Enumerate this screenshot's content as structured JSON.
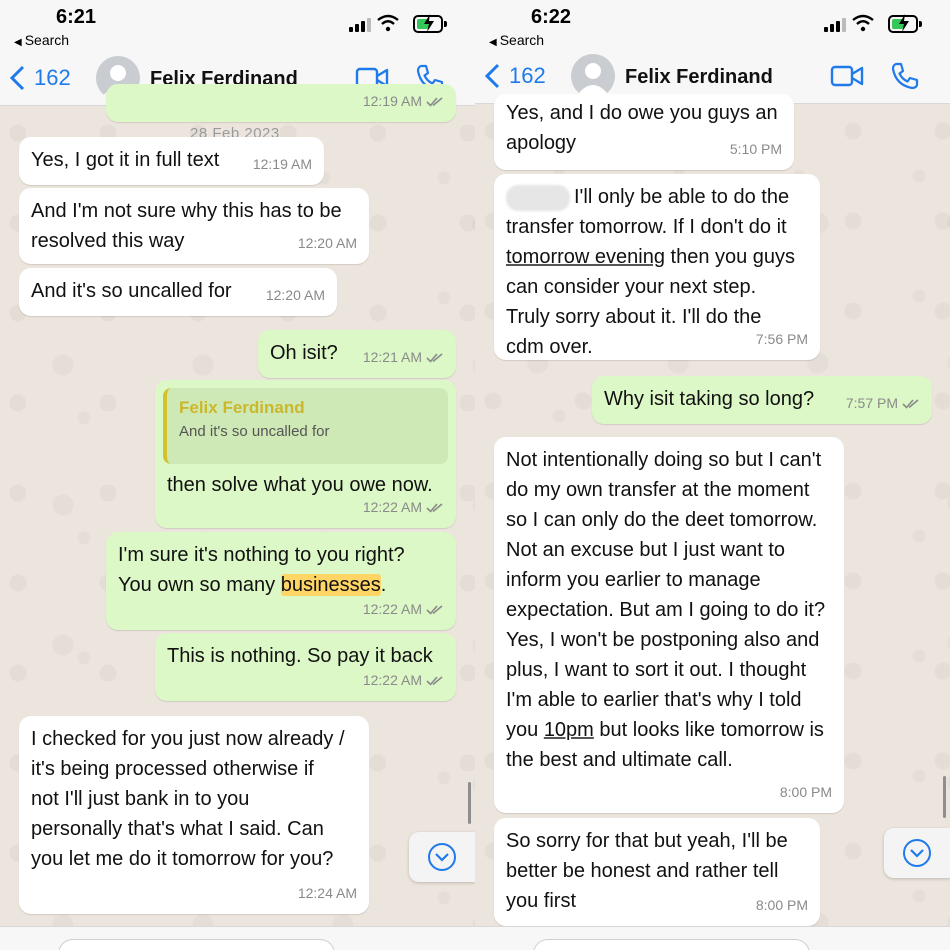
{
  "left": {
    "status": {
      "time": "6:21",
      "back_app": "Search"
    },
    "header": {
      "back_count": "162",
      "contact_name": "Felix Ferdinand"
    },
    "date_chip": "28 Feb 2023",
    "top_partial_time": "12:19 AM",
    "messages": [
      {
        "dir": "in",
        "text": "Yes, I got it in full text",
        "time": "12:19 AM"
      },
      {
        "dir": "in",
        "text": "And I'm not sure why this has to be resolved this way",
        "time": "12:20 AM"
      },
      {
        "dir": "in",
        "text": "And it's so uncalled for",
        "time": "12:20 AM"
      },
      {
        "dir": "out",
        "text": "Oh isit?",
        "time": "12:21 AM"
      },
      {
        "dir": "out",
        "quote_name": "Felix Ferdinand",
        "quote_text": "And it's so uncalled for",
        "text": "then solve what you owe now.",
        "time": "12:22 AM"
      },
      {
        "dir": "out",
        "text_a": "I'm sure it's nothing to you right? You own so many ",
        "text_hl": "businesses",
        "text_b": ".",
        "time": "12:22 AM"
      },
      {
        "dir": "out",
        "text": "This is nothing. So pay it back",
        "time": "12:22 AM"
      },
      {
        "dir": "in",
        "text": "I checked for you just now already / it's being processed otherwise if not I'll just bank in to you personally that's what I said. Can you let me do it tomorrow for you?",
        "time": "12:24 AM"
      }
    ]
  },
  "right": {
    "status": {
      "time": "6:22",
      "back_app": "Search"
    },
    "header": {
      "back_count": "162",
      "contact_name": "Felix Ferdinand"
    },
    "messages": [
      {
        "dir": "in",
        "text": "Yes, and I do owe you guys an apology",
        "time": "5:10 PM"
      },
      {
        "dir": "in",
        "text_a": "I'll only be able to do the transfer tomorrow. If I don't do it ",
        "text_ul": "tomorrow evening",
        "text_b": " then you guys can consider your next step. Truly sorry about it. I'll do the cdm over.",
        "time": "7:56 PM"
      },
      {
        "dir": "out",
        "text": "Why isit taking so long?",
        "time": "7:57 PM"
      },
      {
        "dir": "in",
        "text_a": "Not intentionally doing so but I can't do my own transfer at the moment so I can only do the deet tomorrow. Not an excuse but I just want to inform you earlier to manage expectation. But am I going to do it? Yes, I won't be postponing also and plus, I want to sort it out. I thought I'm able to earlier that's why I told you ",
        "text_ul": "10pm",
        "text_b": " but looks like tomorrow is the best and ultimate call.",
        "time": "8:00 PM"
      },
      {
        "dir": "in",
        "text": "So sorry for that but yeah, I'll be better be honest and rather tell you first",
        "time": "8:00 PM"
      }
    ]
  },
  "colors": {
    "accent": "#1f7aeb",
    "incoming": "#ffffff",
    "outgoing": "#dcf8c6",
    "chat_bg": "#ece5dd",
    "quote_name": "#cbb82a",
    "highlight": "#ffd666"
  },
  "icons": [
    "chevron-left-icon",
    "avatar-icon",
    "video-call-icon",
    "phone-icon",
    "double-check-icon",
    "scroll-down-icon"
  ]
}
